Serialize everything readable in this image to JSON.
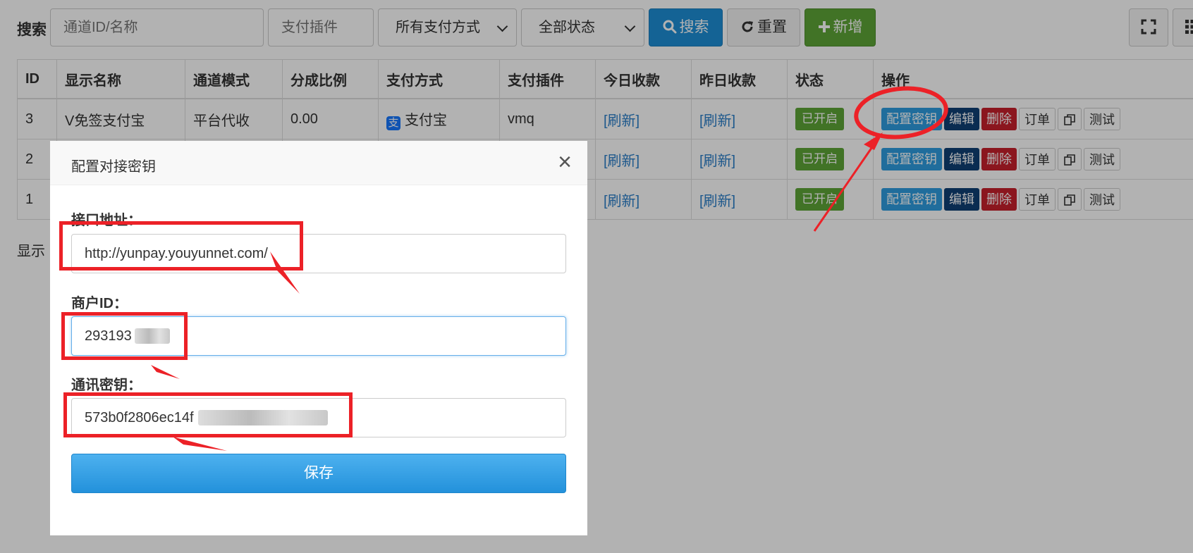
{
  "toolbar": {
    "search_label": "搜索",
    "channel_placeholder": "通道ID/名称",
    "plugin_placeholder": "支付插件",
    "pay_method_selected": "所有支付方式",
    "status_selected": "全部状态",
    "search_button": "搜索",
    "reset_button": "重置",
    "add_button": "新增"
  },
  "table": {
    "columns": [
      "ID",
      "显示名称",
      "通道模式",
      "分成比例",
      "支付方式",
      "支付插件",
      "今日收款",
      "昨日收款",
      "状态",
      "操作"
    ],
    "rows": [
      {
        "id": "3",
        "name": "V免签支付宝",
        "mode": "平台代收",
        "ratio": "0.00",
        "pay_method": "支付宝",
        "plugin": "vmq",
        "today": "[刷新]",
        "yesterday": "[刷新]",
        "status": "已开启"
      },
      {
        "id": "2",
        "name": "",
        "mode": "",
        "ratio": "",
        "pay_method": "",
        "plugin": "",
        "today": "[刷新]",
        "yesterday": "[刷新]",
        "status": "已开启"
      },
      {
        "id": "1",
        "name": "",
        "mode": "",
        "ratio": "",
        "pay_method": "",
        "plugin": "",
        "today": "[刷新]",
        "yesterday": "[刷新]",
        "status": "已开启"
      }
    ],
    "actions": {
      "config_key": "配置密钥",
      "edit": "编辑",
      "delete": "删除",
      "order": "订单",
      "test": "测试"
    },
    "pay_icon_glyph": "支"
  },
  "footer": {
    "text": "显示"
  },
  "modal": {
    "title": "配置对接密钥",
    "close": "×",
    "api_label": "接口地址：",
    "api_value": "http://yunpay.youyunnet.com/",
    "merchant_label": "商户ID：",
    "merchant_value": "293193",
    "key_label": "通讯密钥：",
    "key_value": "573b0f2806ec14f",
    "save_button": "保存"
  },
  "colors": {
    "primary": "#1e8fd6",
    "success": "#5da537",
    "danger": "#c8202b",
    "annotation": "#ec2127"
  },
  "icons": [
    "search-icon",
    "refresh-icon",
    "plus-icon",
    "fullscreen-icon",
    "grid-icon",
    "chevron-down-icon",
    "copy-icon",
    "alipay-icon",
    "close-icon"
  ]
}
